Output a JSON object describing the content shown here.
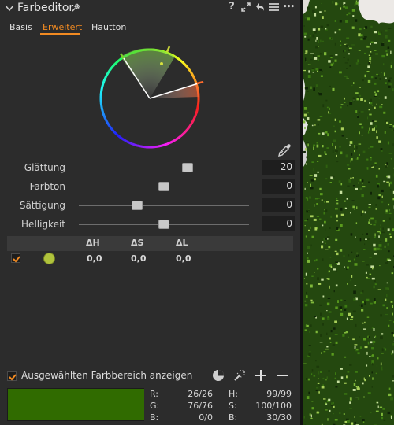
{
  "header": {
    "title": "Farbeditor",
    "icons": [
      "chevron-down-icon",
      "pin-icon",
      "help-icon",
      "expand-icon",
      "reset-icon",
      "menu-icon",
      "more-icon"
    ],
    "help_glyph": "?",
    "more_glyph": "•••"
  },
  "tabs": [
    {
      "label": "Basis",
      "active": false
    },
    {
      "label": "Erweitert",
      "active": true
    },
    {
      "label": "Hautton",
      "active": false
    }
  ],
  "accent_color": "#f28b22",
  "sliders": [
    {
      "label": "Glättung",
      "value": "20",
      "level": 0.64
    },
    {
      "label": "Farbton",
      "value": "0",
      "level": 0.5
    },
    {
      "label": "Sättigung",
      "value": "0",
      "level": 0.34
    },
    {
      "label": "Helligkeit",
      "value": "0",
      "level": 0.5
    }
  ],
  "table": {
    "headers": [
      "ΔH",
      "ΔS",
      "ΔL"
    ],
    "rows": [
      {
        "checked": true,
        "swatch_color": "#b0c33c",
        "dh": "0,0",
        "ds": "0,0",
        "dl": "0,0"
      }
    ]
  },
  "show_range": {
    "checked": true,
    "label": "Ausgewählten Farbbereich anzeigen"
  },
  "preview": {
    "color_before": "#306b00",
    "color_after": "#306b00"
  },
  "readout": {
    "r_label": "R:",
    "r_value": "26/26",
    "g_label": "G:",
    "g_value": "76/76",
    "b_label": "B:",
    "b_value": "0/0",
    "h_label": "H:",
    "h_value": "99/99",
    "s_label": "S:",
    "s_value": "100/100",
    "bl_label": "B:",
    "bl_value": "30/30"
  }
}
